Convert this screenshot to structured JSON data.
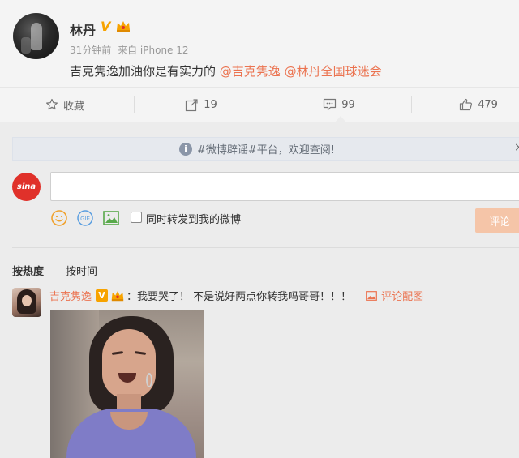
{
  "post": {
    "username": "林丹",
    "verified_badge": "V",
    "time": "31分钟前",
    "source": "来自 iPhone 12",
    "text": "吉克隽逸加油你是有实力的 ",
    "mentions": [
      "@吉克隽逸",
      "@林丹全国球迷会"
    ]
  },
  "actions": {
    "favorite_label": "收藏",
    "repost_count": "19",
    "comment_count": "99",
    "like_count": "479"
  },
  "notice": {
    "icon": "i",
    "text": "#微博辟谣#平台，欢迎查阅!",
    "close": "×"
  },
  "composer": {
    "logo_text": "sina",
    "input_value": "",
    "gif_label": "GIF",
    "repost_label": "同时转发到我的微博",
    "submit_label": "评论"
  },
  "sort": {
    "hot_label": "按热度",
    "time_label": "按时间"
  },
  "comment": {
    "name": "吉克隽逸",
    "badge": "V",
    "text": "：我要哭了！ 不是说好两点你转我吗哥哥！！！",
    "pic_link": "评论配图"
  },
  "colors": {
    "accent": "#eb7350",
    "verified": "#f7a300",
    "sina_red": "#e0312a",
    "submit_disabled": "#f5c5a8"
  }
}
